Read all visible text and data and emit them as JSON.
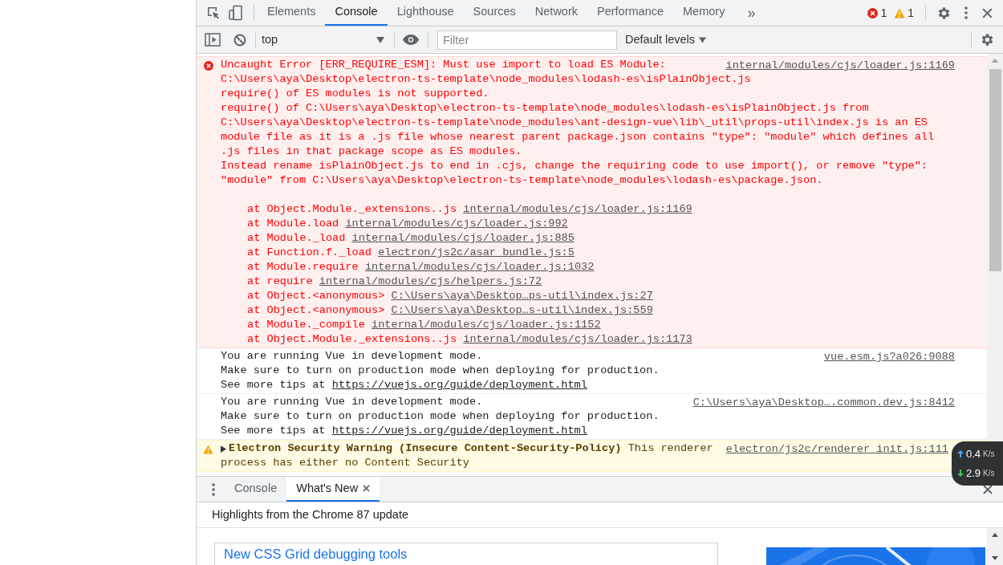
{
  "toolbar": {
    "tabs": [
      {
        "label": "Elements",
        "selected": false
      },
      {
        "label": "Console",
        "selected": true
      },
      {
        "label": "Lighthouse",
        "selected": false
      },
      {
        "label": "Sources",
        "selected": false
      },
      {
        "label": "Network",
        "selected": false
      },
      {
        "label": "Performance",
        "selected": false
      },
      {
        "label": "Memory",
        "selected": false
      }
    ],
    "more": "»",
    "error_count": "1",
    "warning_count": "1"
  },
  "console_toolbar": {
    "context": "top",
    "filter_placeholder": "Filter",
    "levels": "Default levels"
  },
  "messages": [
    {
      "kind": "error",
      "source": "internal/modules/cjs/loader.js:1169",
      "lines": [
        "Uncaught Error [ERR_REQUIRE_ESM]: Must use import to load ES Module:",
        "C:\\Users\\aya\\Desktop\\electron-ts-template\\node_modules\\lodash-es\\isPlainObject.js",
        "require() of ES modules is not supported.",
        "require() of C:\\Users\\aya\\Desktop\\electron-ts-template\\node_modules\\lodash-es\\isPlainObject.js from",
        "C:\\Users\\aya\\Desktop\\electron-ts-template\\node_modules\\ant-design-vue\\lib\\_util\\props-util\\index.js is an ES",
        "module file as it is a .js file whose nearest parent package.json contains \"type\": \"module\" which defines all",
        ".js files in that package scope as ES modules.",
        "Instead rename isPlainObject.js to end in .cjs, change the requiring code to use import(), or remove \"type\":",
        "\"module\" from C:\\Users\\aya\\Desktop\\electron-ts-template\\node_modules\\lodash-es\\package.json."
      ],
      "stack": [
        {
          "at": "at Object.Module._extensions..js",
          "link": "internal/modules/cjs/loader.js:1169"
        },
        {
          "at": "at Module.load",
          "link": "internal/modules/cjs/loader.js:992"
        },
        {
          "at": "at Module._load",
          "link": "internal/modules/cjs/loader.js:885"
        },
        {
          "at": "at Function.f._load",
          "link": "electron/js2c/asar_bundle.js:5"
        },
        {
          "at": "at Module.require",
          "link": "internal/modules/cjs/loader.js:1032"
        },
        {
          "at": "at require",
          "link": "internal/modules/cjs/helpers.js:72"
        },
        {
          "at": "at Object.<anonymous>",
          "link": "C:\\Users\\aya\\Desktop…ps-util\\index.js:27"
        },
        {
          "at": "at Object.<anonymous>",
          "link": "C:\\Users\\aya\\Desktop…s-util\\index.js:559"
        },
        {
          "at": "at Module._compile",
          "link": "internal/modules/cjs/loader.js:1152"
        },
        {
          "at": "at Object.Module._extensions..js",
          "link": "internal/modules/cjs/loader.js:1173"
        }
      ]
    },
    {
      "kind": "info",
      "source": "vue.esm.js?a026:9088",
      "lines": [
        "You are running Vue in development mode.",
        "Make sure to turn on production mode when deploying for production."
      ],
      "tip": {
        "text": "See more tips at",
        "link": "https://vuejs.org/guide/deployment.html"
      }
    },
    {
      "kind": "info",
      "source": "C:\\Users\\aya\\Desktop….common.dev.js:8412",
      "lines": [
        "You are running Vue in development mode.",
        "Make sure to turn on production mode when deploying for production."
      ],
      "tip": {
        "text": "See more tips at",
        "link": "https://vuejs.org/guide/deployment.html"
      }
    },
    {
      "kind": "warning",
      "expanded": false,
      "source": "electron/js2c/renderer_init.js:111",
      "title": "Electron Security Warning (Insecure Content-Security-Policy)",
      "text": "This renderer",
      "continuation": "process has either no Content Security"
    }
  ],
  "drawer": {
    "tabs": [
      {
        "label": "Console",
        "selected": false,
        "closable": false
      },
      {
        "label": "What's New",
        "selected": true,
        "closable": true
      }
    ],
    "headline": "Highlights from the Chrome 87 update",
    "card_title": "New CSS Grid debugging tools"
  },
  "net_speed": {
    "up": {
      "value": "0.4",
      "unit": "K/s"
    },
    "down": {
      "value": "2.9",
      "unit": "K/s"
    }
  }
}
